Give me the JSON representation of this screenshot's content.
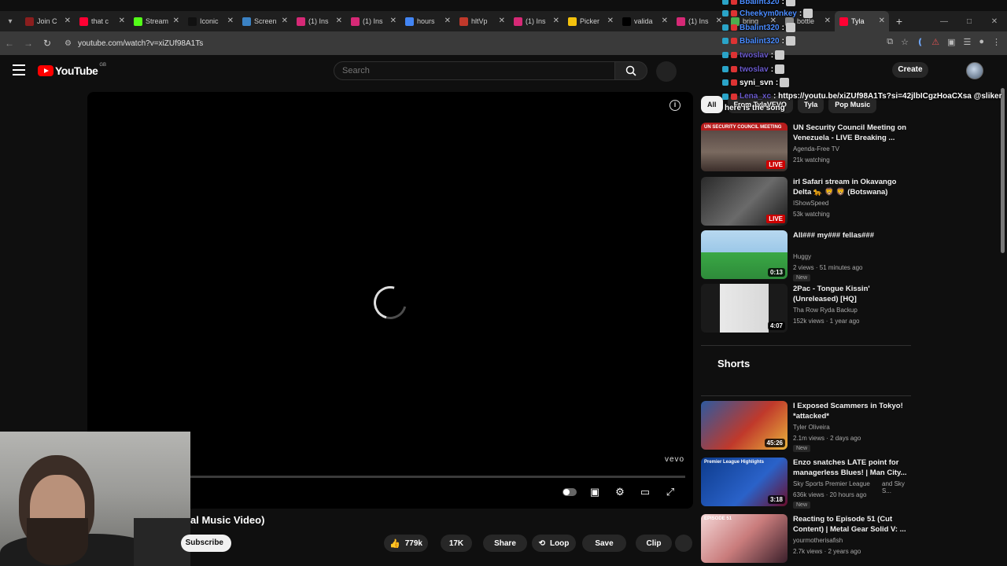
{
  "browser": {
    "tabs": [
      {
        "title": "Join C",
        "color": "#8b1e1e"
      },
      {
        "title": "that c",
        "color": "#ff0033"
      },
      {
        "title": "Stream",
        "color": "#53fc18"
      },
      {
        "title": "Iconic",
        "color": "#111111"
      },
      {
        "title": "Screen",
        "color": "#3b82c4"
      },
      {
        "title": "(1) Ins",
        "color": "#d62976"
      },
      {
        "title": "(1) Ins",
        "color": "#d62976"
      },
      {
        "title": "hours",
        "color": "#4285f4"
      },
      {
        "title": "hltVp",
        "color": "#c0392b"
      },
      {
        "title": "(1) Ins",
        "color": "#d62976"
      },
      {
        "title": "Picker",
        "color": "#f4c20d"
      },
      {
        "title": "valida",
        "color": "#000000"
      },
      {
        "title": "(1) Ins",
        "color": "#d62976"
      },
      {
        "title": "bring",
        "color": "#4caf50"
      },
      {
        "title": "bottle",
        "color": "#888888"
      },
      {
        "title": "Tyla",
        "color": "#ff0033"
      }
    ],
    "url": "youtube.com/watch?v=xiZUf98A1Ts"
  },
  "header": {
    "logo_word": "YouTube",
    "region": "GB",
    "search_placeholder": "Search",
    "create_label": "Create"
  },
  "video": {
    "title_fragment": "al Music Video)",
    "watermark": "vevo",
    "subscribe_label": "Subscribe",
    "likes": "779k",
    "comments": "17K",
    "share_label": "Share",
    "loop_label": "Loop",
    "save_label": "Save",
    "clip_label": "Clip"
  },
  "chips": [
    "All",
    "From TylaVEVO",
    "Tyla",
    "Pop Music"
  ],
  "recommendations": [
    {
      "title": "UN Security Council Meeting on Venezuela - LIVE Breaking ...",
      "channel": "Agenda-Free TV",
      "meta": "21k watching",
      "badge": "LIVE",
      "thumb_text": "UN SECURITY COUNCIL MEETING"
    },
    {
      "title": "irl Safari stream in Okavango Delta 🐆 🦁 🦁 (Botswana)",
      "channel": "IShowSpeed",
      "meta": "53k watching",
      "badge": "LIVE"
    },
    {
      "title": "All### my### fellas###",
      "channel": "Huggy",
      "meta": "2 views · 51 minutes ago",
      "badge": "0:13",
      "new": "New"
    },
    {
      "title": "2Pac - Tongue Kissin' (Unreleased) [HQ]",
      "channel": "Tha Row Ryda Backup",
      "meta": "152k views · 1 year ago",
      "badge": "4:07"
    }
  ],
  "shorts_heading": "Shorts",
  "shorts": [
    {
      "title": "I Exposed Scammers in Tokyo! *attacked*",
      "channel": "Tyler Oliveira",
      "meta": "2.1m views · 2 days ago",
      "badge": "45:26",
      "new": "New"
    },
    {
      "title": "Enzo snatches LATE point for managerless Blues! | Man City...",
      "channel": "Sky Sports Premier League",
      "channel_extra": "and Sky S...",
      "meta": "636k views · 20 hours ago",
      "badge": "3:18",
      "new": "New",
      "thumb_text": "Premier League Highlights"
    },
    {
      "title": "Reacting to Episode 51 (Cut Content) | Metal Gear Solid V: ...",
      "channel": "yourmotherisafish",
      "meta": "2.7k views · 2 years ago",
      "thumb_text": "EPISODE 51"
    }
  ],
  "chat": [
    {
      "user": "Bbalint320",
      "msg": ":",
      "color": "#4a8cff"
    },
    {
      "user": "Cheekym0nkey",
      "msg": ":",
      "color": "#4a8cff"
    },
    {
      "user": "Bbalint320",
      "msg": ":",
      "color": "#4a8cff"
    },
    {
      "user": "Bbalint320",
      "msg": ":",
      "color": "#4a8cff"
    },
    {
      "user": "twoslav",
      "msg": ":",
      "color": "#6a5acd"
    },
    {
      "user": "twoslav",
      "msg": ":",
      "color": "#6a5acd"
    },
    {
      "user": "syni_svn",
      "msg": ":",
      "color": "#ffffff"
    },
    {
      "user": "Lena_xc",
      "msg": ": https://youtu.be/xiZUf98A1Ts?si=42jlbICgzHoaCXsa @sliker",
      "color": "#6a5acd"
    },
    {
      "user": "",
      "msg": "here is the song",
      "color": "#ffffff"
    }
  ]
}
